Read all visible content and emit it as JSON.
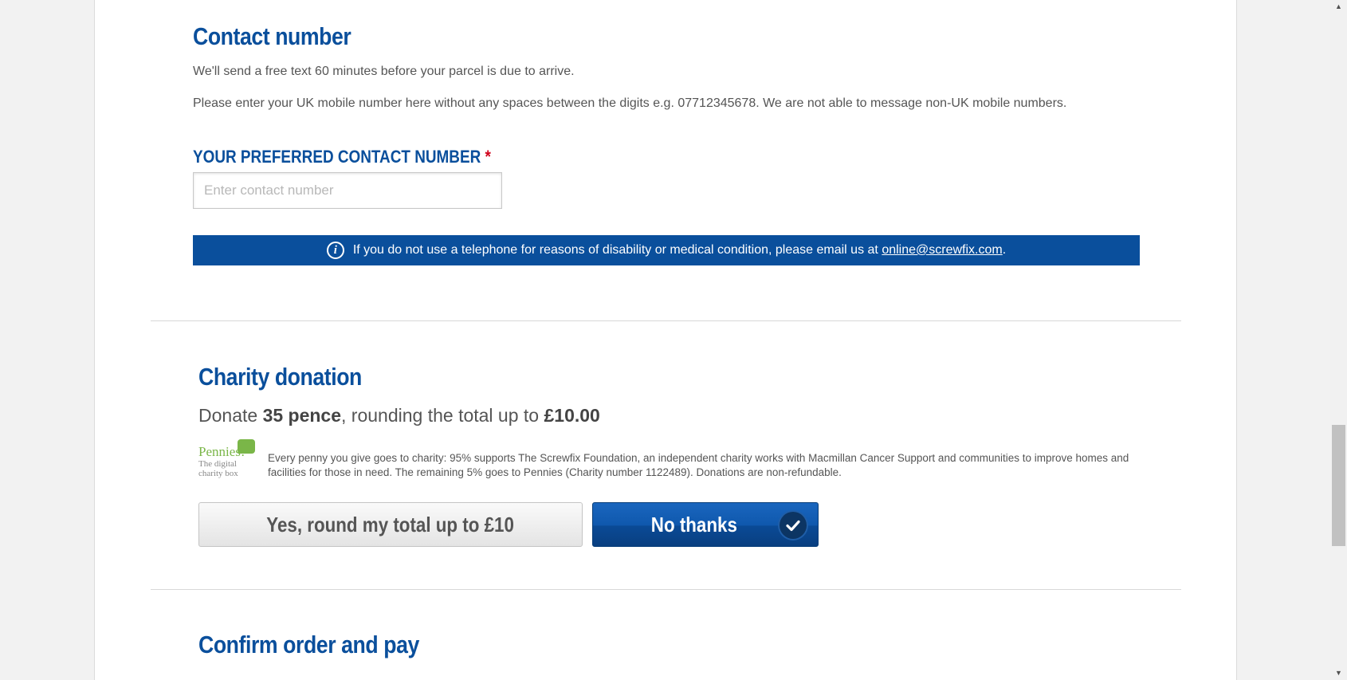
{
  "contact": {
    "heading": "Contact number",
    "para1": "We'll send a free text 60 minutes before your parcel is due to arrive.",
    "para2": "Please enter your UK mobile number here without any spaces between the digits e.g. 07712345678. We are not able to message non-UK mobile numbers.",
    "field_label": "YOUR PREFERRED CONTACT NUMBER",
    "required_mark": "*",
    "input_value": "",
    "input_placeholder": "Enter contact number",
    "info_icon": "info-icon",
    "info_text": "If you do not use a telephone for reasons of disability or medical condition, please email us at",
    "info_email": "online@screwfix.com",
    "info_end": "."
  },
  "charity": {
    "heading": "Charity donation",
    "donate_prefix": "Donate",
    "donate_amount": "35 pence",
    "donate_middle": ", rounding the total up to",
    "donate_total": "£10.00",
    "logo_name": "Pennies!",
    "logo_line1": "The digital",
    "logo_line2": "charity box",
    "description": "Every penny you give goes to charity: 95% supports The Screwfix Foundation, an independent charity works with Macmillan Cancer Support and communities to improve homes and facilities for those in need. The remaining 5% goes to Pennies (Charity number 1122489). Donations are non-refundable.",
    "yes_label": "Yes, round my total up to £10",
    "no_label": "No thanks",
    "selected": "no_thanks"
  },
  "confirm": {
    "heading": "Confirm order and pay"
  },
  "colors": {
    "brand_blue": "#0a4f9c",
    "required_red": "#d0021b",
    "pennies_green": "#7ab648"
  }
}
